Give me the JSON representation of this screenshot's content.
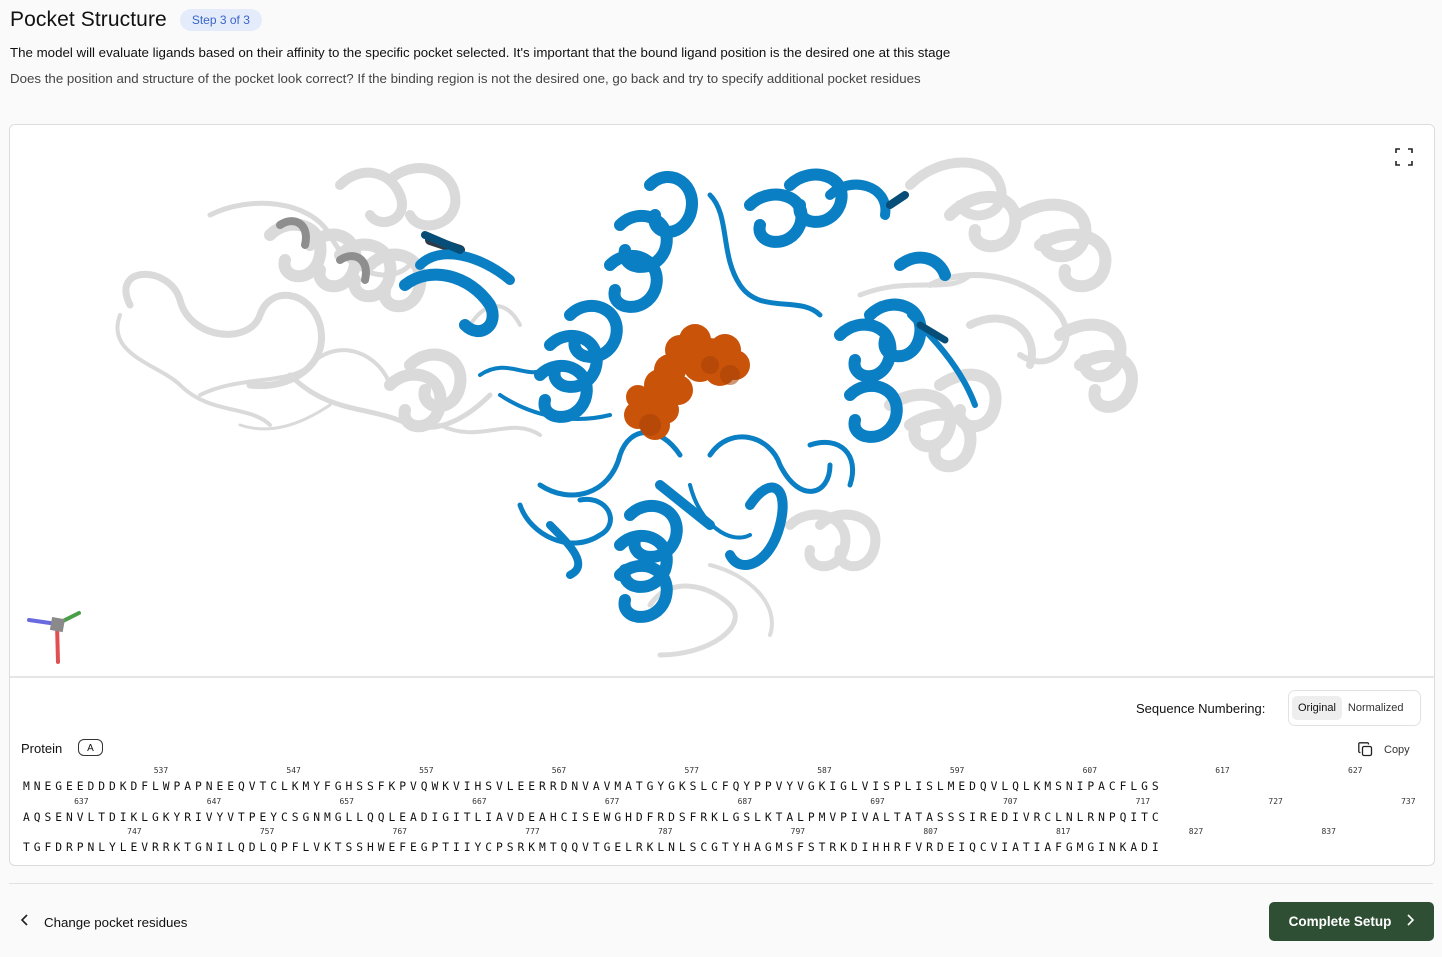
{
  "header": {
    "title": "Pocket Structure",
    "step_badge": "Step 3 of 3",
    "description": "The model will evaluate ligands based on their affinity to the specific pocket selected. It's important that the bound ligand position is the desired one at this stage",
    "question": "Does the position and structure of the pocket look correct? If the binding region is not the desired one, go back and try to specify additional pocket residues"
  },
  "viewer": {
    "fullscreen_icon": "expand-icon",
    "axes_icon": "axes-gizmo-icon",
    "colors": {
      "pocket": "#0a7fc4",
      "ligand": "#c85309",
      "protein": "#d9d9d9"
    }
  },
  "sequence": {
    "numbering_label": "Sequence Numbering:",
    "numbering_options": [
      "Original",
      "Normalized"
    ],
    "numbering_selected": "Original",
    "protein_label": "Protein",
    "chain": "A",
    "copy_label": "Copy",
    "lines": [
      {
        "residues": "MNEGEEDDDKDFLWPAPNEEQVTCLKMYFGHSSFKPVQWKVIHSVLEERRDNVAVMATGYGKSLCFQYPPVYVGKIGLVISPLISLMEDQVLQLKMSNIPACFLGS",
        "markers": [
          {
            "label": "537",
            "index": 10
          },
          {
            "label": "547",
            "index": 20
          },
          {
            "label": "557",
            "index": 30
          },
          {
            "label": "567",
            "index": 40
          },
          {
            "label": "577",
            "index": 50
          },
          {
            "label": "587",
            "index": 60
          },
          {
            "label": "597",
            "index": 70
          },
          {
            "label": "607",
            "index": 80
          },
          {
            "label": "617",
            "index": 90
          },
          {
            "label": "627",
            "index": 100
          }
        ]
      },
      {
        "residues": "AQSENVLTDIKLGKYRIVYVTPEYCSGNMGLLQQLEADIGITLIAVDEAHCISEWGHDFRDSFRKLGSLKTALPMVPIVALTATASSSIREDIVRCLNLRNPQITC",
        "markers": [
          {
            "label": "637",
            "index": 4
          },
          {
            "label": "647",
            "index": 14
          },
          {
            "label": "657",
            "index": 24
          },
          {
            "label": "667",
            "index": 34
          },
          {
            "label": "677",
            "index": 44
          },
          {
            "label": "687",
            "index": 54
          },
          {
            "label": "697",
            "index": 64
          },
          {
            "label": "707",
            "index": 74
          },
          {
            "label": "717",
            "index": 84
          },
          {
            "label": "727",
            "index": 94
          },
          {
            "label": "737",
            "index": 104
          }
        ]
      },
      {
        "residues": "TGFDRPNLYLEVRRKTGNILQDLQPFLVKTSSHWEFEGPTIIYCPSRKMTQQVTGELRKLNLSCGTYHAGMSFSTRKDIHHRFVRDEIQCVIATIAFGMGINKADI",
        "markers": [
          {
            "label": "747",
            "index": 8
          },
          {
            "label": "757",
            "index": 18
          },
          {
            "label": "767",
            "index": 28
          },
          {
            "label": "777",
            "index": 38
          },
          {
            "label": "787",
            "index": 48
          },
          {
            "label": "797",
            "index": 58
          },
          {
            "label": "807",
            "index": 68
          },
          {
            "label": "817",
            "index": 78
          },
          {
            "label": "827",
            "index": 88
          },
          {
            "label": "837",
            "index": 98
          }
        ]
      }
    ]
  },
  "footer": {
    "back_label": "Change pocket residues",
    "complete_label": "Complete Setup"
  }
}
